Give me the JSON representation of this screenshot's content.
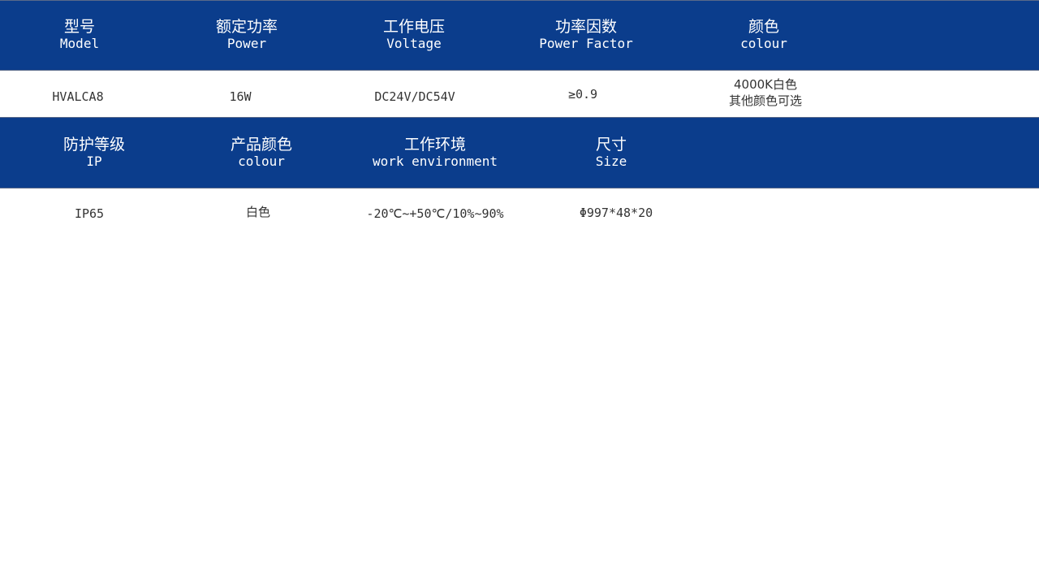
{
  "table": {
    "header_row_1": [
      {
        "zh": "型号",
        "en": "Model"
      },
      {
        "zh": "额定功率",
        "en": "Power"
      },
      {
        "zh": "工作电压",
        "en": "Voltage"
      },
      {
        "zh": "功率因数",
        "en": "Power Factor"
      },
      {
        "zh": "颜色",
        "en": "colour"
      }
    ],
    "value_row_1": [
      "HVALCA8",
      "16W",
      "DC24V/DC54V",
      "≥0.9",
      [
        "4000K白色",
        "其他颜色可选"
      ]
    ],
    "header_row_2": [
      {
        "zh": "防护等级",
        "en": "IP"
      },
      {
        "zh": "产品颜色",
        "en": "colour"
      },
      {
        "zh": "工作环境",
        "en": "work environment"
      },
      {
        "zh": "尺寸",
        "en": "Size"
      }
    ],
    "value_row_2": [
      "IP65",
      "白色",
      "-20℃~+50℃/10%~90%",
      "Φ997*48*20"
    ]
  },
  "colors": {
    "header_band": "#0b3d8c",
    "header_text": "#ffffff",
    "value_text": "#333333"
  }
}
